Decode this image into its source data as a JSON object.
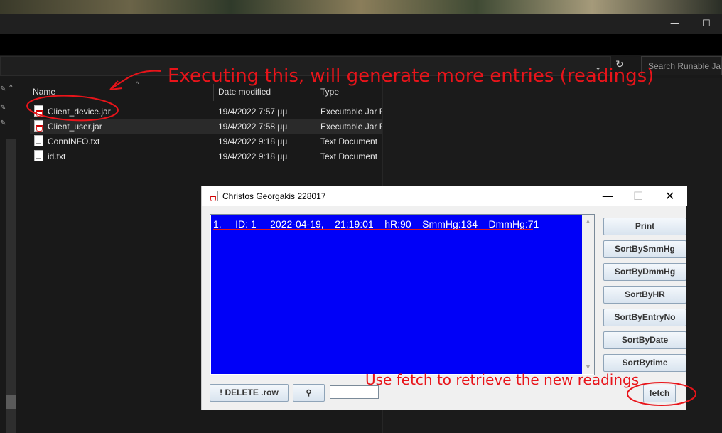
{
  "explorer": {
    "search_placeholder": "Search Runable Jars",
    "window_controls": {
      "minimize": "—",
      "maximize": "☐"
    },
    "columns": {
      "name": "Name",
      "date": "Date modified",
      "type": "Type"
    },
    "files": [
      {
        "name": "Client_device.jar",
        "date": "19/4/2022 7:57 μμ",
        "type": "Executable Jar Fi",
        "icon": "jar-icon"
      },
      {
        "name": "Client_user.jar",
        "date": "19/4/2022 7:58 μμ",
        "type": "Executable Jar Fi",
        "icon": "jar-icon"
      },
      {
        "name": "ConnINFO.txt",
        "date": "19/4/2022 9:18 μμ",
        "type": "Text Document",
        "icon": "text-file-icon"
      },
      {
        "name": "id.txt",
        "date": "19/4/2022 9:18 μμ",
        "type": "Text Document",
        "icon": "text-file-icon"
      }
    ]
  },
  "annotations": {
    "top": "Executing this, will generate more entries (readings)",
    "bottom": "Use fetch to retrieve the new readings",
    "color": "#e8141a"
  },
  "java_window": {
    "title": "Christos Georgakis 228017",
    "controls": {
      "minimize": "—",
      "maximize": "☐",
      "close": "✕"
    },
    "entries": [
      "1.     ID: 1     2022-04-19,    21:19:01    hR:90    SmmHg:134    DmmHg:71"
    ],
    "list_background": "#0000f8",
    "buttons": {
      "print": "Print",
      "sort_smmhg": "SortBySmmHg",
      "sort_dmmhg": "SortByDmmHg",
      "sort_hr": "SortByHR",
      "sort_entry": "SortByEntryNo",
      "sort_date": "SortByDate",
      "sort_time": "SortBytime",
      "delete_row": "! DELETE .row",
      "search": "🔍",
      "fetch": "fetch"
    },
    "search_value": ""
  }
}
